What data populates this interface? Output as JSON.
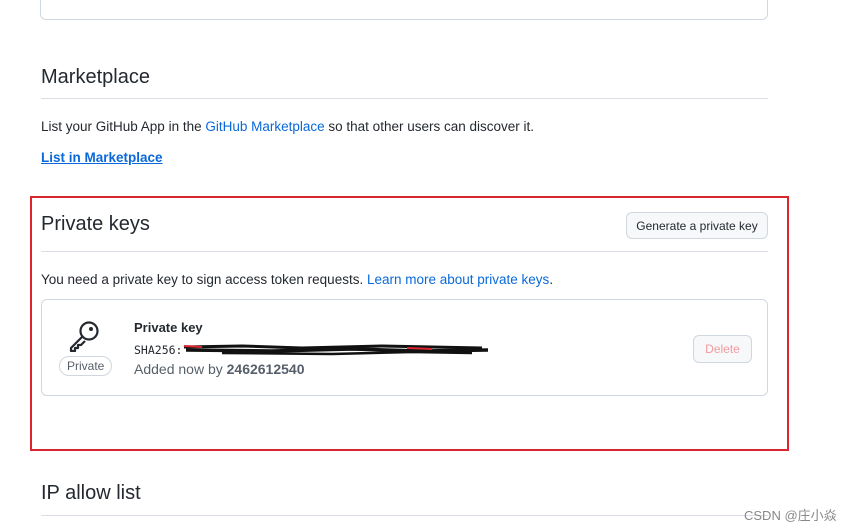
{
  "marketplace": {
    "title": "Marketplace",
    "desc_prefix": "List your GitHub App in the ",
    "desc_link": "GitHub Marketplace",
    "desc_suffix": " so that other users can discover it.",
    "list_link": "List in Marketplace"
  },
  "private_keys": {
    "title": "Private keys",
    "generate_button": "Generate a private key",
    "desc_prefix": "You need a private key to sign access token requests. ",
    "desc_link": "Learn more about private keys",
    "desc_suffix": ".",
    "key": {
      "icon": "key-icon",
      "badge": "Private",
      "name": "Private key",
      "sha_prefix": "SHA256:",
      "added_prefix": "Added now by ",
      "added_by": "2462612540",
      "delete_button": "Delete"
    }
  },
  "ip_allow_list": {
    "title": "IP allow list"
  },
  "watermark": "CSDN @庄小焱",
  "colors": {
    "link": "#0969da",
    "highlight_border": "#d9262f",
    "delete_text": "#f39a9f"
  }
}
